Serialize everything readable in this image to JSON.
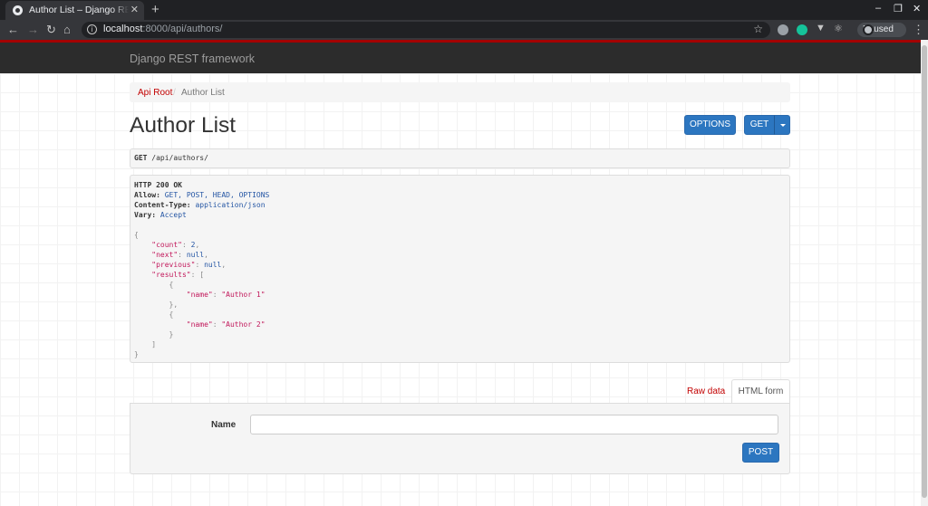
{
  "browser": {
    "tab_title": "Author List – Django REST framework",
    "new_tab": "+",
    "close": "✕",
    "url_host": "localhost",
    "url_path": ":8000/api/authors/",
    "profile_status": "Paused"
  },
  "navbar": {
    "brand": "Django REST framework"
  },
  "breadcrumb": {
    "root": "Api Root",
    "separator": "/",
    "current": "Author List"
  },
  "page": {
    "title": "Author List",
    "options_button": "OPTIONS",
    "get_button": "GET"
  },
  "request": {
    "method": "GET",
    "path": "/api/authors/"
  },
  "response": {
    "status": "HTTP 200 OK",
    "headers": [
      {
        "name": "Allow:",
        "value": "GET, POST, HEAD, OPTIONS"
      },
      {
        "name": "Content-Type:",
        "value": "application/json"
      },
      {
        "name": "Vary:",
        "value": "Accept"
      }
    ],
    "body": {
      "open": "{",
      "count_key": "\"count\"",
      "count_value": "2",
      "next_key": "\"next\"",
      "next_value": "null",
      "previous_key": "\"previous\"",
      "previous_value": "null",
      "results_key": "\"results\"",
      "results_open": "[",
      "results_close": "]",
      "close": "}",
      "items": [
        {
          "name_key": "\"name\"",
          "name_value": "\"Author 1\""
        },
        {
          "name_key": "\"name\"",
          "name_value": "\"Author 2\""
        }
      ]
    }
  },
  "form_tabs": {
    "raw": "Raw data",
    "html": "HTML form"
  },
  "form": {
    "name_label": "Name",
    "name_value": "",
    "post_button": "POST"
  }
}
